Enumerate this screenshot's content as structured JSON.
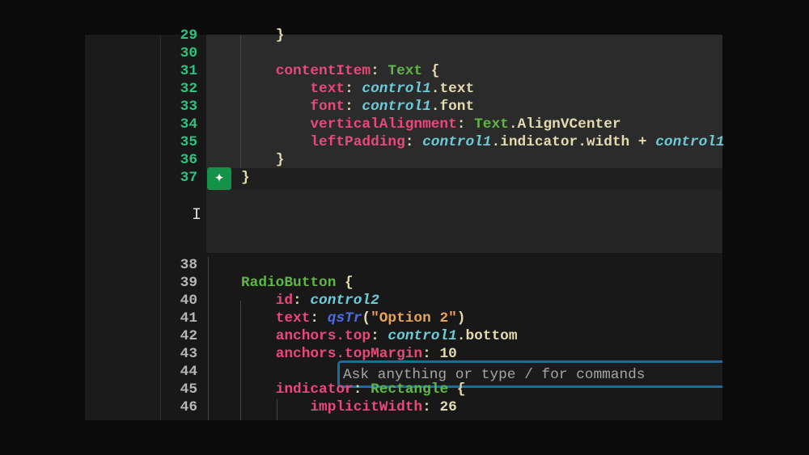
{
  "chat": {
    "placeholder": "Ask anything or type / for commands"
  },
  "colors": {
    "keyword": "#e8487a",
    "type": "#5fb548",
    "var": "#6ccad6",
    "accent": "#1d6c9c",
    "sparkle": "#15924a"
  },
  "icons": {
    "ai": "sparkle-icon",
    "cursor": "text-cursor-icon"
  },
  "top_lines": [
    {
      "n": "29",
      "tokens": [
        [
          "    ",
          "p"
        ],
        [
          "}",
          "p"
        ]
      ]
    },
    {
      "n": "30",
      "tokens": []
    },
    {
      "n": "31",
      "tokens": [
        [
          "    ",
          "p"
        ],
        [
          "contentItem",
          "k"
        ],
        [
          ": ",
          "p"
        ],
        [
          "Text",
          "t"
        ],
        [
          " {",
          "p"
        ]
      ]
    },
    {
      "n": "32",
      "tokens": [
        [
          "        ",
          "p"
        ],
        [
          "text",
          "k"
        ],
        [
          ": ",
          "p"
        ],
        [
          "control1",
          "v"
        ],
        [
          ".text",
          "p"
        ]
      ]
    },
    {
      "n": "33",
      "tokens": [
        [
          "        ",
          "p"
        ],
        [
          "font",
          "k"
        ],
        [
          ": ",
          "p"
        ],
        [
          "control1",
          "v"
        ],
        [
          ".font",
          "p"
        ]
      ]
    },
    {
      "n": "34",
      "tokens": [
        [
          "        ",
          "p"
        ],
        [
          "verticalAlignment",
          "k"
        ],
        [
          ": ",
          "p"
        ],
        [
          "Text",
          "t"
        ],
        [
          ".AlignVCenter",
          "p"
        ]
      ]
    },
    {
      "n": "35",
      "tokens": [
        [
          "        ",
          "p"
        ],
        [
          "leftPadding",
          "k"
        ],
        [
          ": ",
          "p"
        ],
        [
          "control1",
          "v"
        ],
        [
          ".indicator.width + ",
          "p"
        ],
        [
          "control1",
          "v"
        ]
      ]
    },
    {
      "n": "36",
      "tokens": [
        [
          "    ",
          "p"
        ],
        [
          "}",
          "p"
        ]
      ]
    },
    {
      "n": "37",
      "tokens": [
        [
          "}",
          "p"
        ]
      ]
    }
  ],
  "bottom_lines": [
    {
      "n": "38",
      "tokens": []
    },
    {
      "n": "39",
      "tokens": [
        [
          "RadioButton",
          "t"
        ],
        [
          " {",
          "p"
        ]
      ]
    },
    {
      "n": "40",
      "tokens": [
        [
          "    ",
          "p"
        ],
        [
          "id",
          "k"
        ],
        [
          ": ",
          "p"
        ],
        [
          "control2",
          "v"
        ]
      ]
    },
    {
      "n": "41",
      "tokens": [
        [
          "    ",
          "p"
        ],
        [
          "text",
          "k"
        ],
        [
          ": ",
          "p"
        ],
        [
          "qsTr",
          "f"
        ],
        [
          "(",
          "p"
        ],
        [
          "\"Option 2\"",
          "s"
        ],
        [
          ")",
          "p"
        ]
      ]
    },
    {
      "n": "42",
      "tokens": [
        [
          "    ",
          "p"
        ],
        [
          "anchors.top",
          "k"
        ],
        [
          ": ",
          "p"
        ],
        [
          "control1",
          "v"
        ],
        [
          ".bottom",
          "p"
        ]
      ]
    },
    {
      "n": "43",
      "tokens": [
        [
          "    ",
          "p"
        ],
        [
          "anchors.topMargin",
          "k"
        ],
        [
          ": ",
          "p"
        ],
        [
          "10",
          "n"
        ]
      ]
    },
    {
      "n": "44",
      "tokens": []
    },
    {
      "n": "45",
      "tokens": [
        [
          "    ",
          "p"
        ],
        [
          "indicator",
          "k"
        ],
        [
          ": ",
          "p"
        ],
        [
          "Rectangle",
          "t"
        ],
        [
          " {",
          "p"
        ]
      ]
    },
    {
      "n": "46",
      "tokens": [
        [
          "        ",
          "p"
        ],
        [
          "implicitWidth",
          "k"
        ],
        [
          ": ",
          "p"
        ],
        [
          "26",
          "n"
        ]
      ]
    }
  ]
}
